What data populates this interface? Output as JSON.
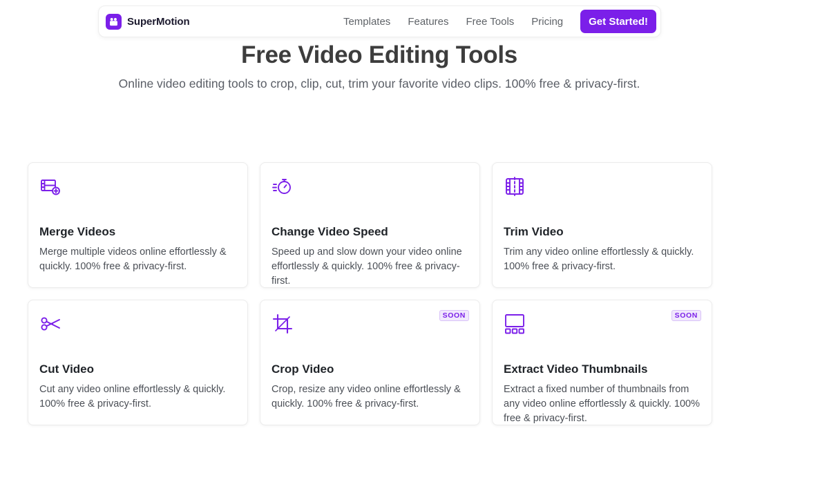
{
  "nav": {
    "brand": "SuperMotion",
    "links": [
      "Templates",
      "Features",
      "Free Tools",
      "Pricing"
    ],
    "cta": "Get Started!"
  },
  "hero": {
    "title": "Free Video Editing Tools",
    "subtitle": "Online video editing tools to crop, clip, cut, trim your favorite video clips. 100% free & privacy-first."
  },
  "tools": [
    {
      "title": "Merge Videos",
      "description": "Merge multiple videos online effortlessly & quickly. 100% free & privacy-first.",
      "icon": "film-plus-icon",
      "badge": ""
    },
    {
      "title": "Change Video Speed",
      "description": "Speed up and slow down your video online effortlessly & quickly. 100% free & privacy-first.",
      "icon": "stopwatch-icon",
      "badge": ""
    },
    {
      "title": "Trim Video",
      "description": "Trim any video online effortlessly & quickly. 100% free & privacy-first.",
      "icon": "trim-film-icon",
      "badge": ""
    },
    {
      "title": "Cut Video",
      "description": "Cut any video online effortlessly & quickly. 100% free & privacy-first.",
      "icon": "scissors-icon",
      "badge": ""
    },
    {
      "title": "Crop Video",
      "description": "Crop, resize any video online effortlessly & quickly. 100% free & privacy-first.",
      "icon": "crop-icon",
      "badge": "SOON"
    },
    {
      "title": "Extract Video Thumbnails",
      "description": "Extract a fixed number of thumbnails from any video online effortlessly & quickly. 100% free & privacy-first.",
      "icon": "thumbnails-icon",
      "badge": "SOON"
    }
  ],
  "colors": {
    "accent": "#7b1fe9",
    "badge_bg": "#f1e8fd",
    "heading": "#3d3d3d"
  }
}
